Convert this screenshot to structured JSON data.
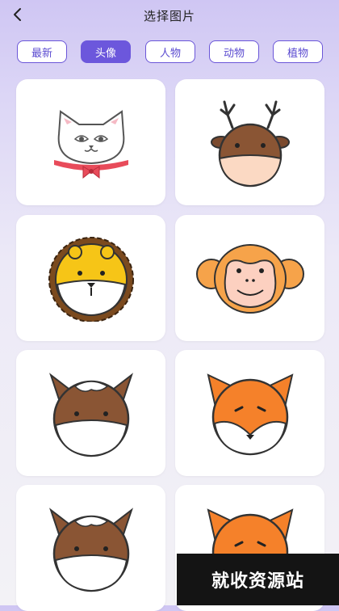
{
  "header": {
    "title": "选择图片",
    "back_icon": "chevron-left-icon"
  },
  "tabs": [
    {
      "label": "最新",
      "active": false
    },
    {
      "label": "头像",
      "active": true
    },
    {
      "label": "人物",
      "active": false
    },
    {
      "label": "动物",
      "active": false
    },
    {
      "label": "植物",
      "active": false
    }
  ],
  "gallery": {
    "items": [
      {
        "subject": "cat-icon"
      },
      {
        "subject": "deer-icon"
      },
      {
        "subject": "lion-icon"
      },
      {
        "subject": "monkey-icon"
      },
      {
        "subject": "horse-icon"
      },
      {
        "subject": "fox-icon"
      },
      {
        "subject": "horse-icon"
      },
      {
        "subject": "fox-icon"
      }
    ]
  },
  "watermark": {
    "text": "就收资源站"
  },
  "colors": {
    "accent": "#6c57dc",
    "tab_border": "#6a56d8"
  }
}
